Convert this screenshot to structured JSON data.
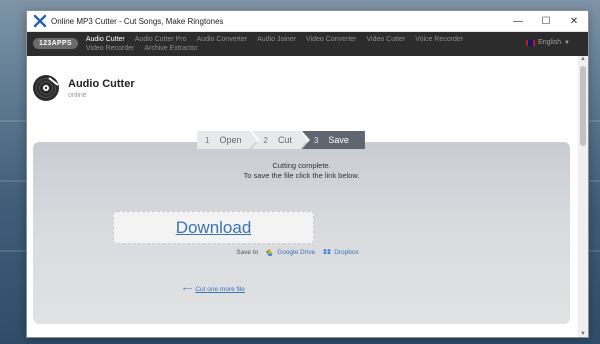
{
  "window": {
    "title": "Online MP3 Cutter - Cut Songs, Make Ringtones",
    "minimize": "—",
    "maximize": "☐",
    "close": "✕"
  },
  "nav": {
    "brand": "123APPS",
    "items": [
      "Audio Cutter",
      "Audio Cutter Pro",
      "Audio Converter",
      "Audio Joiner",
      "Video Converter",
      "Video Cutter",
      "Voice Recorder",
      "Video Recorder",
      "Archive Extractor"
    ],
    "active_index": 0,
    "language": "English"
  },
  "app": {
    "title": "Audio Cutter",
    "subtitle": "online"
  },
  "steps": [
    {
      "num": "1",
      "label": "Open"
    },
    {
      "num": "2",
      "label": "Cut"
    },
    {
      "num": "3",
      "label": "Save"
    }
  ],
  "active_step": 2,
  "result": {
    "line1": "Cutting complete.",
    "line2": "To save the file click the link below.",
    "download": "Download",
    "save_to": "Save to",
    "google_drive": "Google Drive",
    "dropbox": "Dropbox",
    "cut_more": "Cut one more file",
    "cut_more_arrow": "⟵"
  },
  "colors": {
    "navbar": "#2c2c2c",
    "active_step": "#5f6670",
    "link": "#3b72b8"
  },
  "icons": {
    "app": "x-logo-icon",
    "disc": "vinyl-disc-icon",
    "google_drive": "google-drive-icon",
    "dropbox": "dropbox-icon"
  }
}
